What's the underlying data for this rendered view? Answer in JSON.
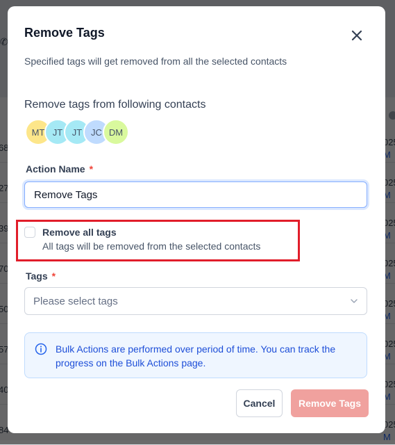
{
  "background": {
    "row_numbers": [
      "68",
      "27",
      "39",
      "70",
      "50",
      "57",
      "40",
      "84"
    ],
    "row_year": "025",
    "row_link": "M"
  },
  "modal": {
    "title": "Remove Tags",
    "subtitle": "Specified tags will get removed from all the selected contacts",
    "contacts_label": "Remove tags from following contacts",
    "avatars": [
      {
        "initials": "MT",
        "color": "#fde68a"
      },
      {
        "initials": "JT",
        "color": "#a5e9f5"
      },
      {
        "initials": "JT",
        "color": "#a5e9f5"
      },
      {
        "initials": "JC",
        "color": "#bfdbfe"
      },
      {
        "initials": "DM",
        "color": "#d9f99d"
      }
    ],
    "action_name": {
      "label": "Action Name",
      "required_mark": "*",
      "value": "Remove Tags"
    },
    "remove_all": {
      "checked": false,
      "title": "Remove all tags",
      "description": "All tags will be removed from the selected contacts"
    },
    "tags": {
      "label": "Tags",
      "required_mark": "*",
      "placeholder": "Please select tags"
    },
    "info": {
      "text": "Bulk Actions are performed over period of time. You can track the progress on the Bulk Actions page."
    },
    "buttons": {
      "cancel": "Cancel",
      "submit": "Remove Tags"
    }
  },
  "colors": {
    "highlight_border": "#e11d2a",
    "primary_disabled": "#f0a19e",
    "info_text": "#1d4ed8"
  }
}
